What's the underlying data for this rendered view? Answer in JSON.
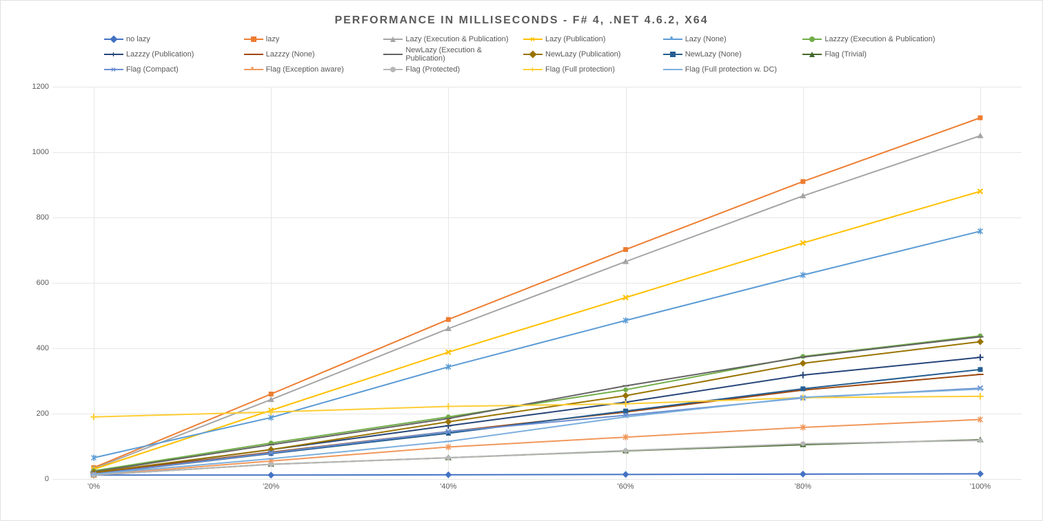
{
  "chart_data": {
    "type": "line",
    "title": "PERFORMANCE IN MILLISECONDS - F# 4, .NET 4.6.2, X64",
    "xlabel": "",
    "ylabel": "",
    "ylim": [
      0,
      1200
    ],
    "yticks": [
      0,
      200,
      400,
      600,
      800,
      1000,
      1200
    ],
    "categories": [
      "'0%",
      "'20%",
      "'40%",
      "'60%",
      "'80%",
      "'100%"
    ],
    "series": [
      {
        "name": "no lazy",
        "color": "#4472C4",
        "marker": "diamond",
        "values": [
          12,
          12,
          13,
          14,
          15,
          16
        ]
      },
      {
        "name": "lazy",
        "color": "#ED7D31",
        "marker": "square",
        "values": [
          35,
          260,
          488,
          702,
          910,
          1105
        ]
      },
      {
        "name": "Lazy (Execution & Publication)",
        "color": "#A5A5A5",
        "marker": "triangle",
        "values": [
          32,
          243,
          460,
          665,
          866,
          1050
        ]
      },
      {
        "name": "Lazy (Publication)",
        "color": "#FFC000",
        "marker": "x",
        "values": [
          30,
          210,
          388,
          555,
          722,
          880
        ]
      },
      {
        "name": "Lazy (None)",
        "color": "#5B9BD5",
        "marker": "asterisk",
        "values": [
          65,
          188,
          343,
          485,
          624,
          758
        ]
      },
      {
        "name": "Lazzzy (Execution & Publication)",
        "color": "#70AD47",
        "marker": "circle",
        "values": [
          25,
          110,
          190,
          273,
          375,
          438
        ]
      },
      {
        "name": "Lazzzy (Publication)",
        "color": "#264478",
        "marker": "plus",
        "values": [
          18,
          90,
          163,
          235,
          318,
          372
        ]
      },
      {
        "name": "Lazzzy (None)",
        "color": "#9E480E",
        "marker": "dash",
        "values": [
          18,
          82,
          145,
          205,
          272,
          320
        ]
      },
      {
        "name": "NewLazy (Execution & Publication)",
        "color": "#636363",
        "marker": "dash",
        "values": [
          22,
          105,
          185,
          285,
          373,
          435
        ]
      },
      {
        "name": "NewLazy (Publication)",
        "color": "#997300",
        "marker": "diamond",
        "values": [
          20,
          90,
          175,
          255,
          354,
          420
        ]
      },
      {
        "name": "NewLazy (None)",
        "color": "#255E91",
        "marker": "square",
        "values": [
          15,
          78,
          140,
          208,
          276,
          335
        ]
      },
      {
        "name": "Flag (Trivial)",
        "color": "#43682B",
        "marker": "triangle",
        "values": [
          12,
          45,
          65,
          86,
          105,
          120
        ]
      },
      {
        "name": "Flag (Compact)",
        "color": "#698ED0",
        "marker": "x",
        "values": [
          15,
          80,
          145,
          195,
          248,
          278
        ]
      },
      {
        "name": "Flag (Exception aware)",
        "color": "#F1975A",
        "marker": "asterisk",
        "values": [
          12,
          55,
          98,
          128,
          158,
          182
        ]
      },
      {
        "name": "Flag (Protected)",
        "color": "#B7B7B7",
        "marker": "circle",
        "values": [
          12,
          45,
          65,
          87,
          108,
          118
        ]
      },
      {
        "name": "Flag (Full protection)",
        "color": "#FFCD33",
        "marker": "plus",
        "values": [
          190,
          205,
          222,
          230,
          249,
          253
        ]
      },
      {
        "name": "Flag (Full protection w. DC)",
        "color": "#7CAFDD",
        "marker": "dash",
        "values": [
          15,
          62,
          115,
          190,
          250,
          275
        ]
      }
    ]
  }
}
